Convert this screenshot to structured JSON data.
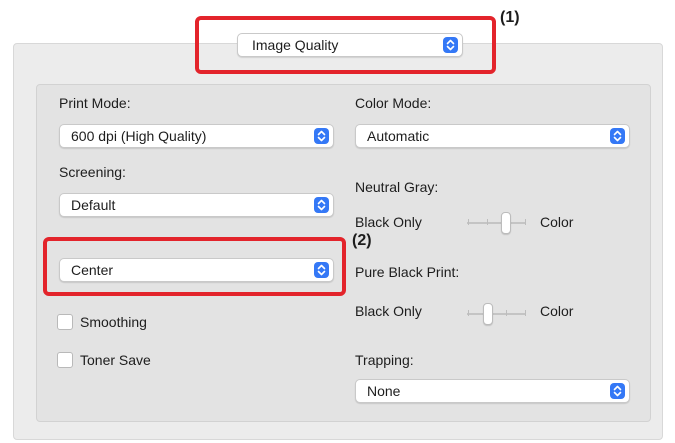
{
  "panel_selector": {
    "value": "Image Quality"
  },
  "callouts": {
    "one": "(1)",
    "two": "(2)"
  },
  "print_mode": {
    "label": "Print Mode:",
    "value": "600 dpi (High Quality)"
  },
  "screening": {
    "label": "Screening:",
    "value": "Default"
  },
  "screen_position": {
    "value": "Center"
  },
  "smoothing": {
    "label": "Smoothing",
    "checked": false
  },
  "toner_save": {
    "label": "Toner Save",
    "checked": false
  },
  "color_mode": {
    "label": "Color Mode:",
    "value": "Automatic"
  },
  "neutral_gray": {
    "label": "Neutral Gray:",
    "left": "Black Only",
    "right": "Color"
  },
  "pure_black_print": {
    "label": "Pure Black Print:",
    "left": "Black Only",
    "right": "Color"
  },
  "trapping": {
    "label": "Trapping:",
    "value": "None"
  },
  "colors": {
    "accent": "#3478f6",
    "highlight": "#e3242b"
  },
  "icons": {
    "stepper": "up-down-chevron-icon"
  }
}
